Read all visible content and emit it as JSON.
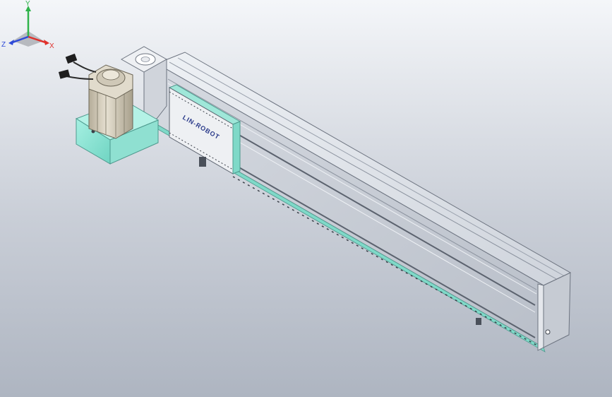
{
  "viewport": {
    "background_top": "#f4f6f9",
    "background_bottom": "#aeb5c1"
  },
  "model": {
    "carriage_logo_text": "LIN-ROBOT",
    "motor_color": "#d9d3c4",
    "accent_color": "#8ee6d6",
    "body_color": "#d7dbe2"
  },
  "triad": {
    "x_label": "X",
    "y_label": "Y",
    "z_label": "Z",
    "x_color": "#e0302b",
    "y_color": "#2fb34a",
    "z_color": "#2f4bd8"
  }
}
